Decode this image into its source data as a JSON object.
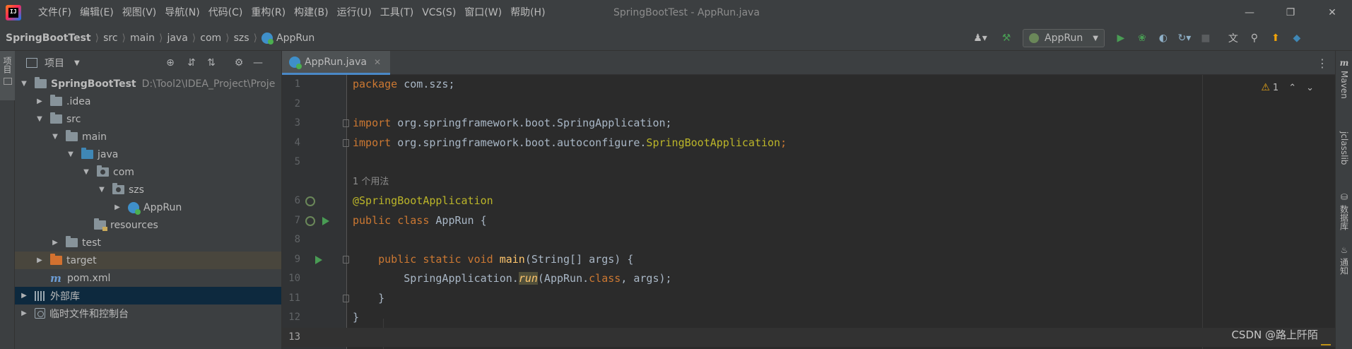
{
  "titlebar": {
    "menu": [
      "文件(F)",
      "编辑(E)",
      "视图(V)",
      "导航(N)",
      "代码(C)",
      "重构(R)",
      "构建(B)",
      "运行(U)",
      "工具(T)",
      "VCS(S)",
      "窗口(W)",
      "帮助(H)"
    ],
    "window_title": "SpringBootTest - AppRun.java",
    "logo_text": "IJ"
  },
  "breadcrumb": [
    "SpringBootTest",
    "src",
    "main",
    "java",
    "com",
    "szs",
    "AppRun"
  ],
  "run_config": "AppRun",
  "left_stripe": {
    "project_tab": "项目"
  },
  "project": {
    "header": "项目",
    "tree": [
      {
        "label": "SpringBootTest",
        "path": "D:\\Tool2\\IDEA_Project\\Proje"
      },
      {
        "label": ".idea"
      },
      {
        "label": "src"
      },
      {
        "label": "main"
      },
      {
        "label": "java"
      },
      {
        "label": "com"
      },
      {
        "label": "szs"
      },
      {
        "label": "AppRun"
      },
      {
        "label": "resources"
      },
      {
        "label": "test"
      },
      {
        "label": "target"
      },
      {
        "label": "pom.xml"
      },
      {
        "label": "外部库"
      },
      {
        "label": "临时文件和控制台"
      }
    ]
  },
  "editor": {
    "tab": {
      "label": "AppRun.java"
    },
    "line_numbers": [
      "1",
      "2",
      "3",
      "4",
      "5",
      "6",
      "7",
      "8",
      "9",
      "10",
      "11",
      "12",
      "13"
    ],
    "usage_hint": "1 个用法",
    "code": {
      "l1_kw": "package",
      "l1_rest": " com.szs;",
      "l3_kw": "import",
      "l3_rest": " org.springframework.boot.SpringApplication;",
      "l4_kw": "import",
      "l4_rest": " org.springframework.boot.autoconfigure.",
      "l4_ann": "SpringBootApplication",
      "l4_end": ";",
      "l6_ann": "@SpringBootApplication",
      "l7_kw": "public class",
      "l7_rest": " AppRun {",
      "l9_indent": "    ",
      "l9_kw": "public static void",
      "l9_space": " ",
      "l9_fn": "main",
      "l9_rest": "(String[] args) {",
      "l10_indent": "        ",
      "l10_pre": "SpringApplication.",
      "l10_fn": "run",
      "l10_mid": "(AppRun.",
      "l10_kw": "class",
      "l10_rest": ", args);",
      "l11": "    }",
      "l12": "}"
    },
    "inspection_count": "1",
    "watermark": "CSDN @路上阡陌"
  },
  "right_stripe": {
    "maven_glyph": "m",
    "maven": "Maven",
    "jclasslib": "jclasslib",
    "database": "数据库",
    "notifications": "通知"
  },
  "colors": {
    "keyword": "#cc7832",
    "annotation": "#bbb529",
    "method": "#ffc66d",
    "identifier": "#a9b7c6",
    "background": "#2b2b2b",
    "panel": "#3c3f41",
    "selection_blue": "#0d293e"
  }
}
